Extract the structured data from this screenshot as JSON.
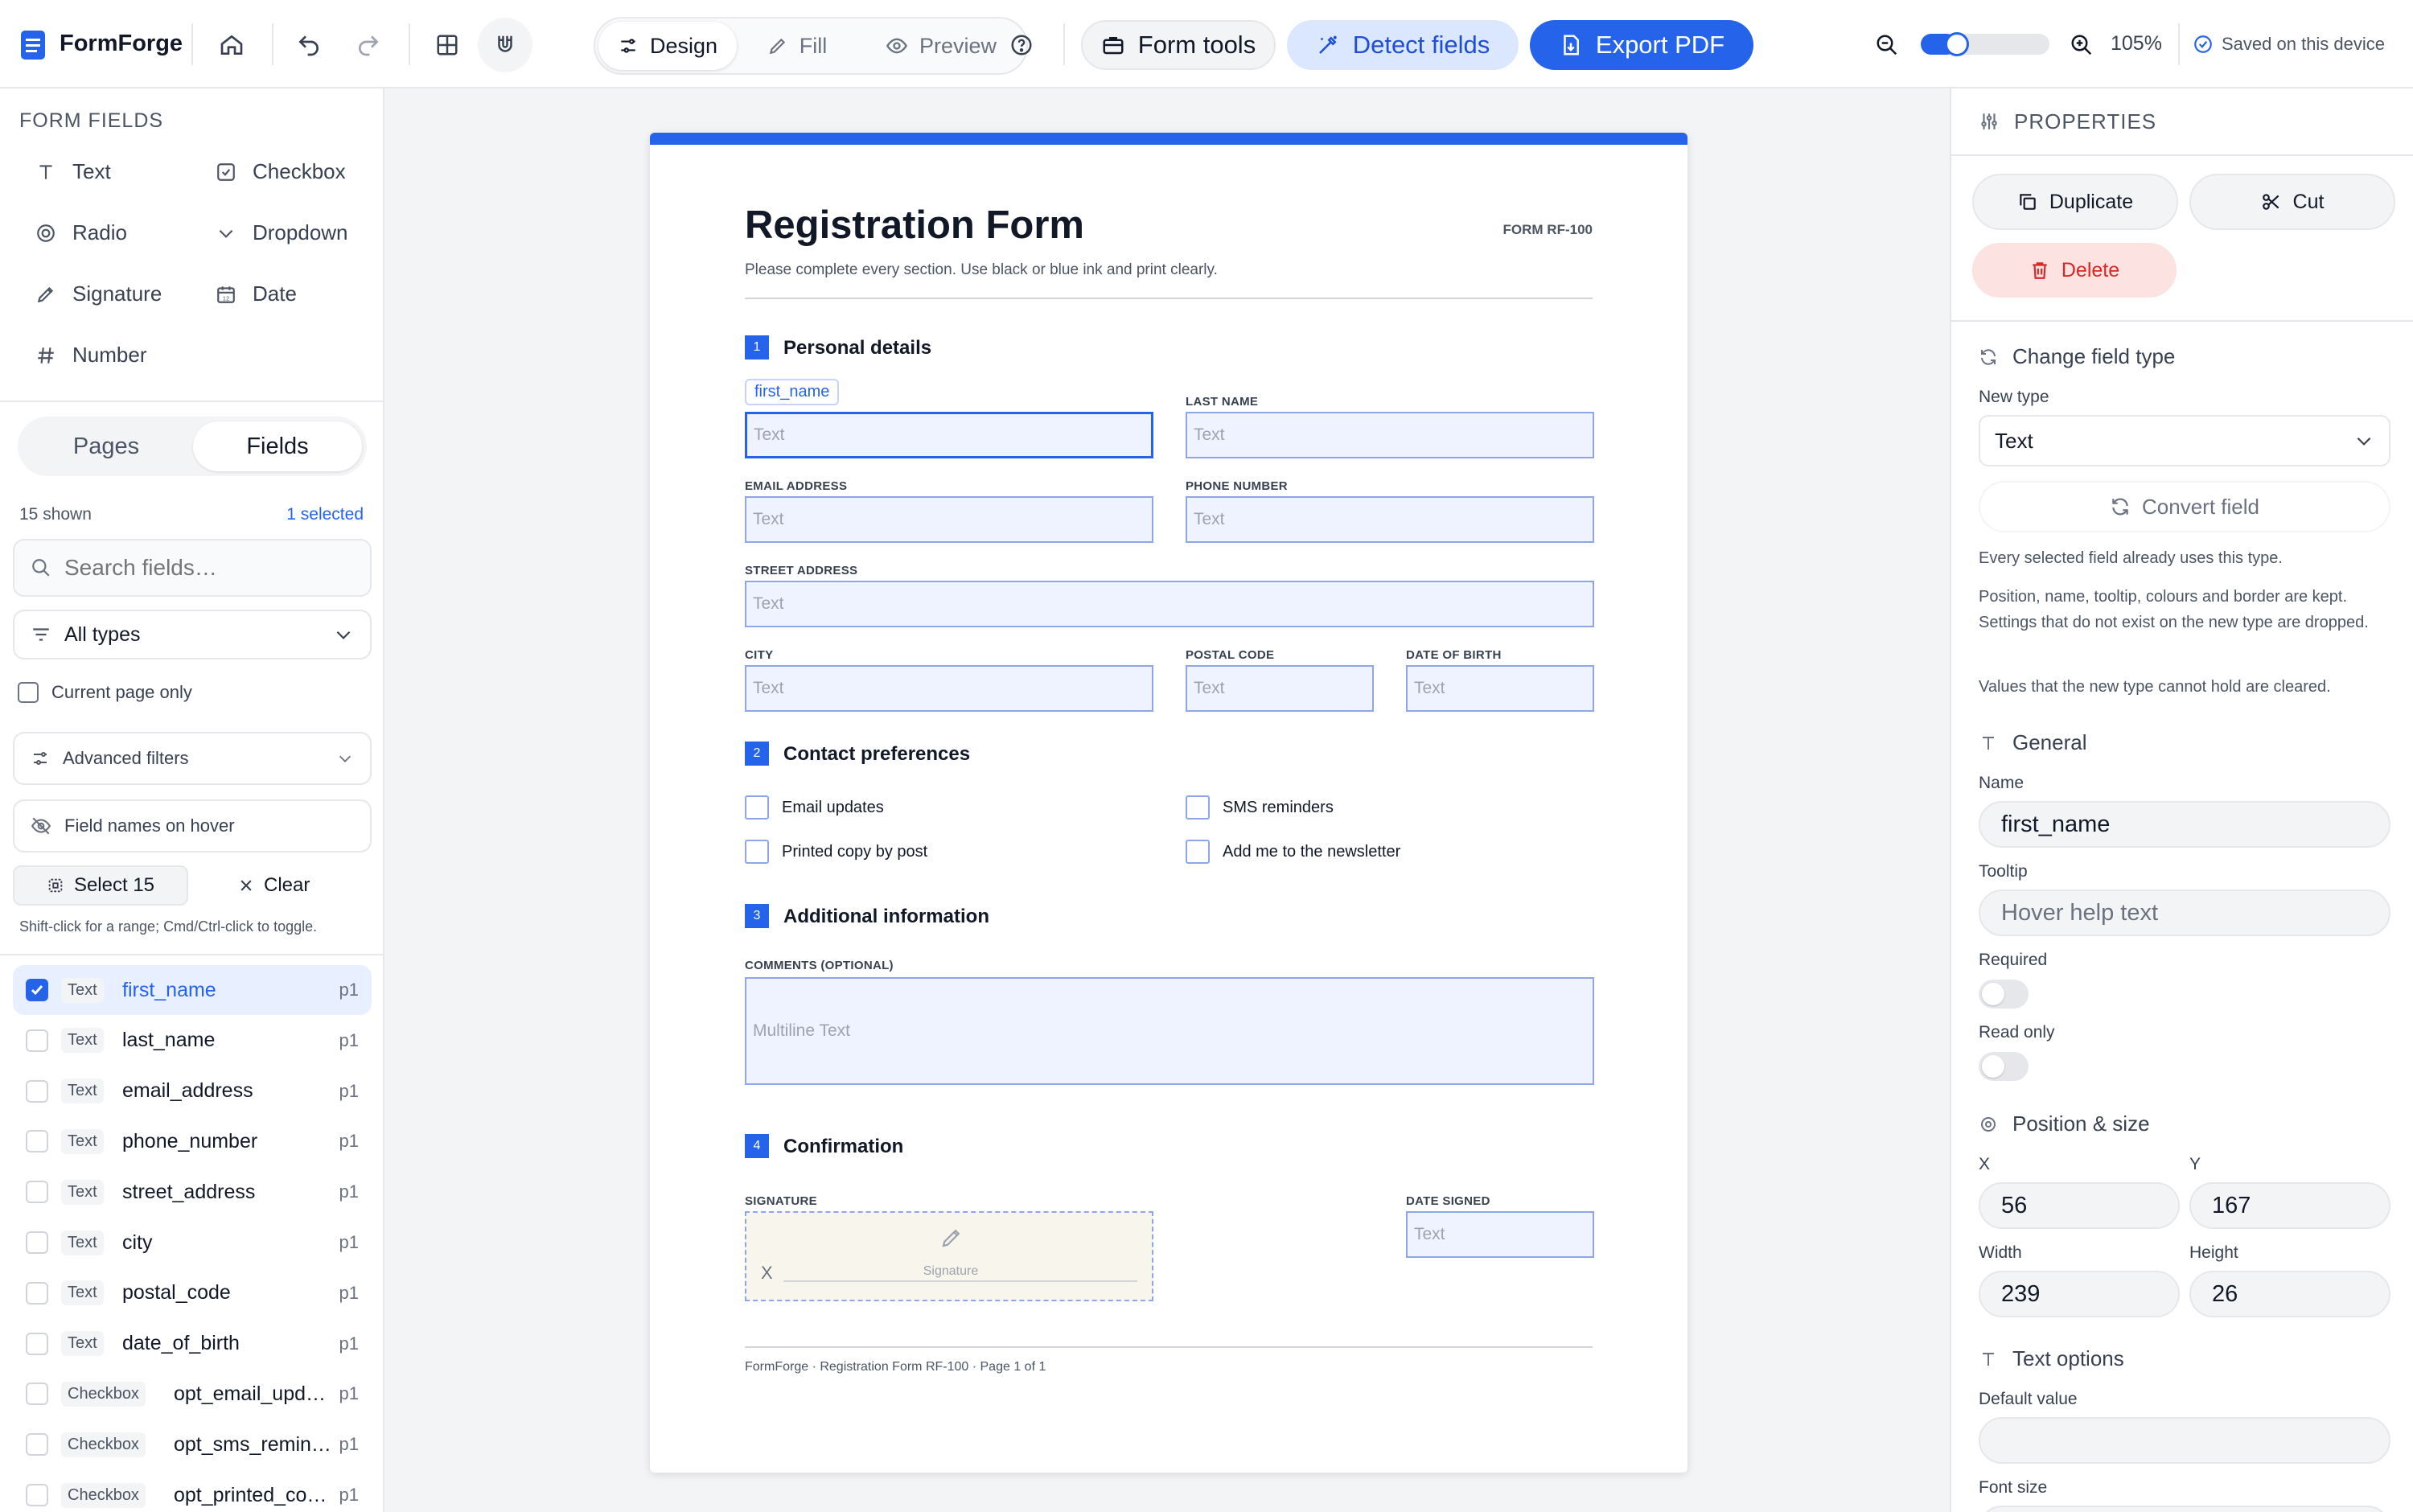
{
  "app": {
    "name": "FormForge",
    "zoom": "105%",
    "zoom_level": 0.28,
    "save_status": "Saved on this device"
  },
  "toolbar": {
    "mode_tabs": [
      {
        "label": "Design",
        "active": true
      },
      {
        "label": "Fill",
        "active": false
      },
      {
        "label": "Preview",
        "active": false
      }
    ],
    "form_tools": "Form tools",
    "detect_fields": "Detect fields",
    "export_pdf": "Export PDF"
  },
  "left": {
    "section_title": "FORM FIELDS",
    "field_types": [
      {
        "label": "Text",
        "icon": "text-icon"
      },
      {
        "label": "Checkbox",
        "icon": "checkbox-icon"
      },
      {
        "label": "Radio",
        "icon": "radio-icon"
      },
      {
        "label": "Dropdown",
        "icon": "chevron-down-icon"
      },
      {
        "label": "Signature",
        "icon": "pen-icon"
      },
      {
        "label": "Date",
        "icon": "calendar-icon"
      },
      {
        "label": "Number",
        "icon": "hash-icon"
      }
    ],
    "date_icon_day": "12",
    "tabs": [
      {
        "label": "Pages",
        "active": false
      },
      {
        "label": "Fields",
        "active": true
      }
    ],
    "shown_count": "15 shown",
    "selected_count": "1 selected",
    "search_placeholder": "Search fields…",
    "type_filter": "All types",
    "current_page_only": "Current page only",
    "advanced_filters": "Advanced filters",
    "field_names_hover": "Field names on hover",
    "select_all": "Select 15",
    "clear": "Clear",
    "hint": "Shift-click for a range; Cmd/Ctrl-click to toggle.",
    "fields": [
      {
        "type": "Text",
        "name": "first_name",
        "page": "p1",
        "selected": true
      },
      {
        "type": "Text",
        "name": "last_name",
        "page": "p1",
        "selected": false
      },
      {
        "type": "Text",
        "name": "email_address",
        "page": "p1",
        "selected": false
      },
      {
        "type": "Text",
        "name": "phone_number",
        "page": "p1",
        "selected": false
      },
      {
        "type": "Text",
        "name": "street_address",
        "page": "p1",
        "selected": false
      },
      {
        "type": "Text",
        "name": "city",
        "page": "p1",
        "selected": false
      },
      {
        "type": "Text",
        "name": "postal_code",
        "page": "p1",
        "selected": false
      },
      {
        "type": "Text",
        "name": "date_of_birth",
        "page": "p1",
        "selected": false
      },
      {
        "type": "Checkbox",
        "name": "opt_email_upd…",
        "page": "p1",
        "selected": false
      },
      {
        "type": "Checkbox",
        "name": "opt_sms_remin…",
        "page": "p1",
        "selected": false
      },
      {
        "type": "Checkbox",
        "name": "opt_printed_co…",
        "page": "p1",
        "selected": false
      }
    ]
  },
  "doc": {
    "title": "Registration Form",
    "form_id": "FORM RF-100",
    "subtitle": "Please complete every section. Use black or blue ink and print clearly.",
    "selected_field_tag": "first_name",
    "text_placeholder": "Text",
    "multiline_placeholder": "Multiline Text",
    "signature_placeholder": "Signature",
    "signature_mark": "X",
    "sections": [
      {
        "num": "1",
        "title": "Personal details"
      },
      {
        "num": "2",
        "title": "Contact preferences"
      },
      {
        "num": "3",
        "title": "Additional information"
      },
      {
        "num": "4",
        "title": "Confirmation"
      }
    ],
    "labels": {
      "last_name": "LAST NAME",
      "email": "EMAIL ADDRESS",
      "phone": "PHONE NUMBER",
      "street": "STREET ADDRESS",
      "city": "CITY",
      "postal": "POSTAL CODE",
      "dob": "DATE OF BIRTH",
      "comments": "COMMENTS (OPTIONAL)",
      "signature": "SIGNATURE",
      "date_signed": "DATE SIGNED"
    },
    "checkboxes": [
      "Email updates",
      "SMS reminders",
      "Printed copy by post",
      "Add me to the newsletter"
    ],
    "footer": "FormForge · Registration Form RF-100 · Page 1 of 1"
  },
  "right": {
    "title": "PROPERTIES",
    "duplicate": "Duplicate",
    "cut": "Cut",
    "delete": "Delete",
    "change_type": "Change field type",
    "new_type_label": "New type",
    "new_type_value": "Text",
    "convert": "Convert field",
    "notes": [
      "Every selected field already uses this type.",
      "Position, name, tooltip, colours and border are kept. Settings that do not exist on the new type are dropped.",
      "Values that the new type cannot hold are cleared."
    ],
    "general": "General",
    "name_label": "Name",
    "name_value": "first_name",
    "tooltip_label": "Tooltip",
    "tooltip_placeholder": "Hover help text",
    "required": "Required",
    "read_only": "Read only",
    "position_size": "Position & size",
    "x_label": "X",
    "x_value": "56",
    "y_label": "Y",
    "y_value": "167",
    "w_label": "Width",
    "w_value": "239",
    "h_label": "Height",
    "h_value": "26",
    "text_options": "Text options",
    "default_value": "Default value",
    "font_size": "Font size"
  },
  "colors": {
    "accent": "#2563eb",
    "delete": "#dc2626",
    "delete_bg": "#fde2e2",
    "field_bg": "#eef3ff",
    "field_border": "#8ea6e6",
    "signature_bg": "#f8f5ec"
  }
}
